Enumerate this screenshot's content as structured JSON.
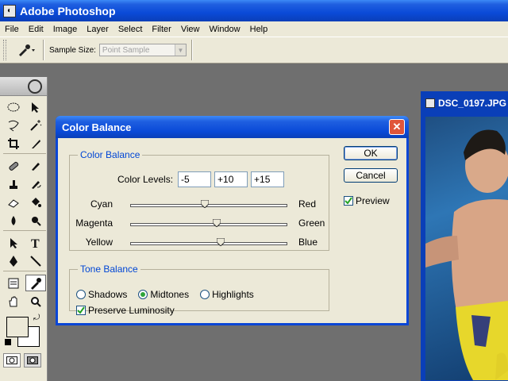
{
  "app": {
    "title": "Adobe Photoshop"
  },
  "menu": [
    "File",
    "Edit",
    "Image",
    "Layer",
    "Select",
    "Filter",
    "View",
    "Window",
    "Help"
  ],
  "options": {
    "sample_size_label": "Sample Size:",
    "sample_size_value": "Point Sample"
  },
  "document": {
    "title": "DSC_0197.JPG"
  },
  "dialog": {
    "title": "Color Balance",
    "color_balance": {
      "legend": "Color Balance",
      "levels_label": "Color Levels:",
      "levels": [
        "-5",
        "+10",
        "+15"
      ],
      "sliders": [
        {
          "left": "Cyan",
          "right": "Red",
          "value": -5
        },
        {
          "left": "Magenta",
          "right": "Green",
          "value": 10
        },
        {
          "left": "Yellow",
          "right": "Blue",
          "value": 15
        }
      ]
    },
    "tone_balance": {
      "legend": "Tone Balance",
      "options": [
        "Shadows",
        "Midtones",
        "Highlights"
      ],
      "selected": "Midtones",
      "preserve_luminosity": "Preserve Luminosity"
    },
    "buttons": {
      "ok": "OK",
      "cancel": "Cancel"
    },
    "preview": "Preview"
  },
  "colors": {
    "titlebar": "#0a4ad8",
    "dialog_bg": "#ece9d8",
    "legend": "#0046d5",
    "close": "#e0553a"
  }
}
